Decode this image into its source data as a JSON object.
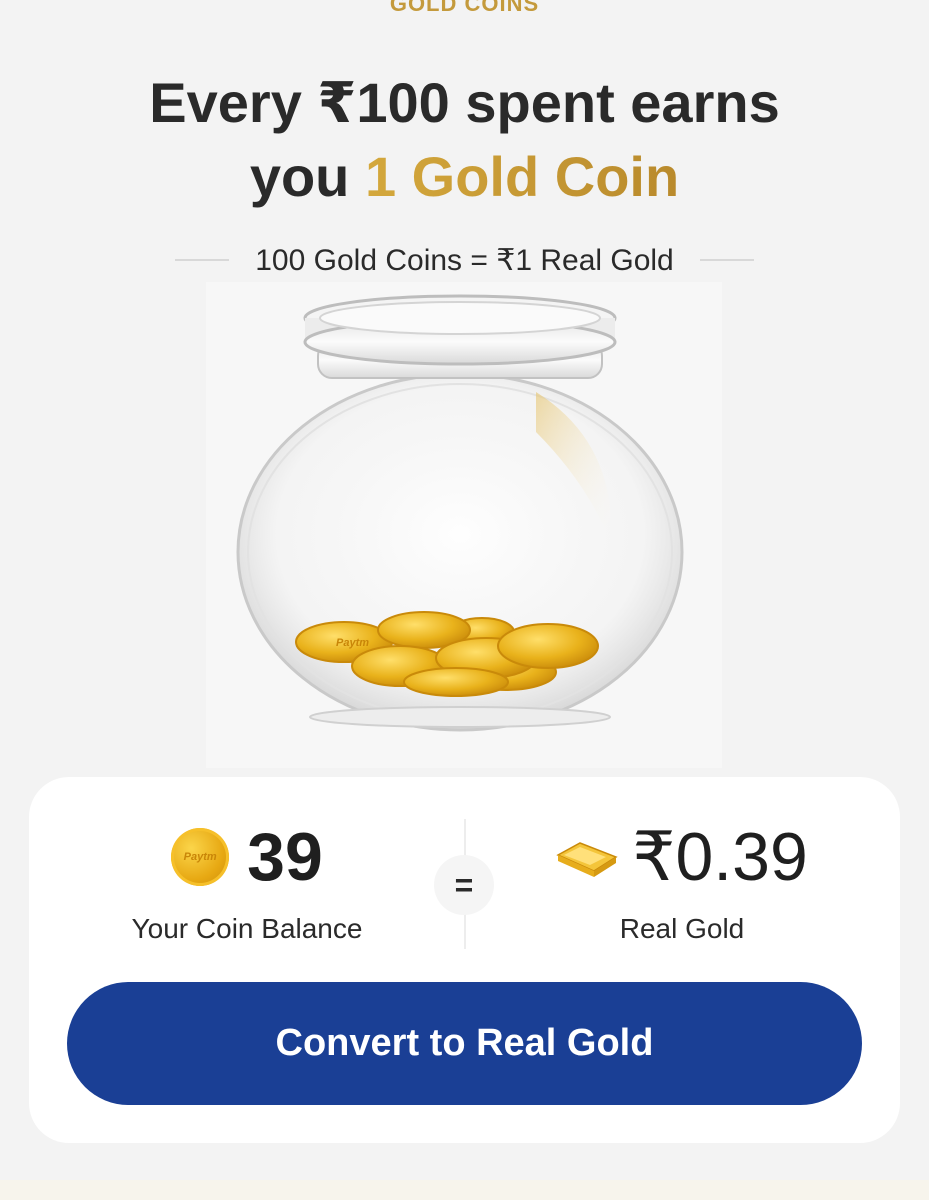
{
  "header": {
    "section_label": "GOLD COINS",
    "headline_line1": "Every ₹100 spent earns",
    "headline_you": "you ",
    "headline_highlight": "1 Gold Coin",
    "conversion_rate": "100 Gold Coins = ₹1 Real Gold"
  },
  "jar": {
    "coin_mark": "Paytm",
    "coin_color": "#e9b21b"
  },
  "summary": {
    "coin_icon_text": "Paytm",
    "coin_balance": "39",
    "coin_balance_label": "Your Coin Balance",
    "equals_sign": "=",
    "real_gold_value": "₹0.39",
    "real_gold_label": "Real Gold"
  },
  "actions": {
    "convert_label": "Convert to Real Gold"
  },
  "colors": {
    "accent_gold": "#c79a34",
    "button_blue": "#1a3f95",
    "text_dark": "#2a2a2a"
  }
}
